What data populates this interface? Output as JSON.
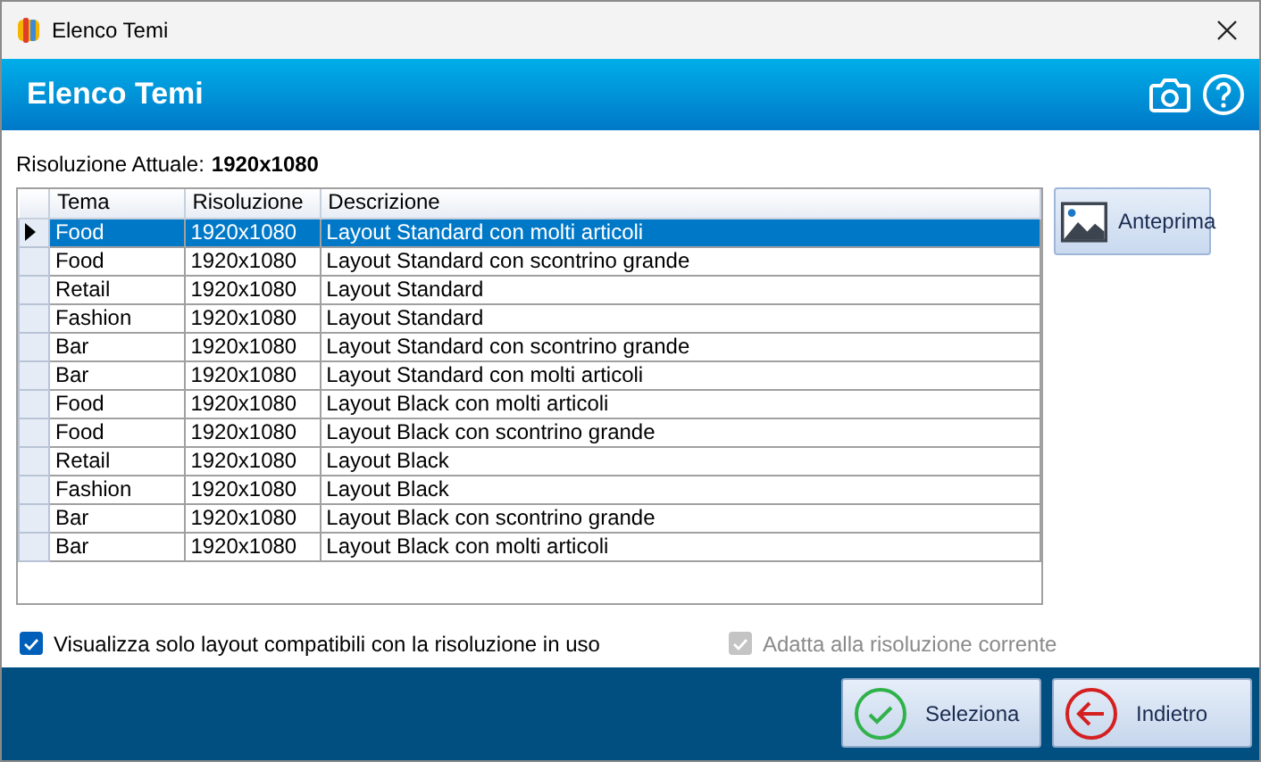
{
  "window": {
    "title": "Elenco Temi"
  },
  "header": {
    "title": "Elenco Temi"
  },
  "resolution": {
    "label": "Risoluzione Attuale:",
    "value": "1920x1080"
  },
  "table": {
    "columns": [
      "Tema",
      "Risoluzione",
      "Descrizione"
    ],
    "rows": [
      {
        "cells": [
          "Food",
          "1920x1080",
          "Layout Standard con molti articoli"
        ],
        "selected": true
      },
      {
        "cells": [
          "Food",
          "1920x1080",
          "Layout Standard con scontrino grande"
        ],
        "selected": false
      },
      {
        "cells": [
          "Retail",
          "1920x1080",
          "Layout Standard"
        ],
        "selected": false
      },
      {
        "cells": [
          "Fashion",
          "1920x1080",
          "Layout Standard"
        ],
        "selected": false
      },
      {
        "cells": [
          "Bar",
          "1920x1080",
          "Layout Standard con scontrino grande"
        ],
        "selected": false
      },
      {
        "cells": [
          "Bar",
          "1920x1080",
          "Layout Standard con molti articoli"
        ],
        "selected": false
      },
      {
        "cells": [
          "Food",
          "1920x1080",
          "Layout Black con molti articoli"
        ],
        "selected": false
      },
      {
        "cells": [
          "Food",
          "1920x1080",
          "Layout Black con scontrino grande"
        ],
        "selected": false
      },
      {
        "cells": [
          "Retail",
          "1920x1080",
          "Layout Black"
        ],
        "selected": false
      },
      {
        "cells": [
          "Fashion",
          "1920x1080",
          "Layout Black"
        ],
        "selected": false
      },
      {
        "cells": [
          "Bar",
          "1920x1080",
          "Layout Black con scontrino grande"
        ],
        "selected": false
      },
      {
        "cells": [
          "Bar",
          "1920x1080",
          "Layout Black con molti articoli"
        ],
        "selected": false
      }
    ]
  },
  "preview_button": {
    "label": "Anteprima"
  },
  "options": [
    {
      "label": "Visualizza solo layout compatibili con la risoluzione in uso",
      "checked": true,
      "disabled": false
    },
    {
      "label": "Adatta alla risoluzione corrente",
      "checked": true,
      "disabled": true
    }
  ],
  "footer_buttons": [
    {
      "label": "Seleziona",
      "kind": "confirm"
    },
    {
      "label": "Indietro",
      "kind": "back"
    }
  ]
}
